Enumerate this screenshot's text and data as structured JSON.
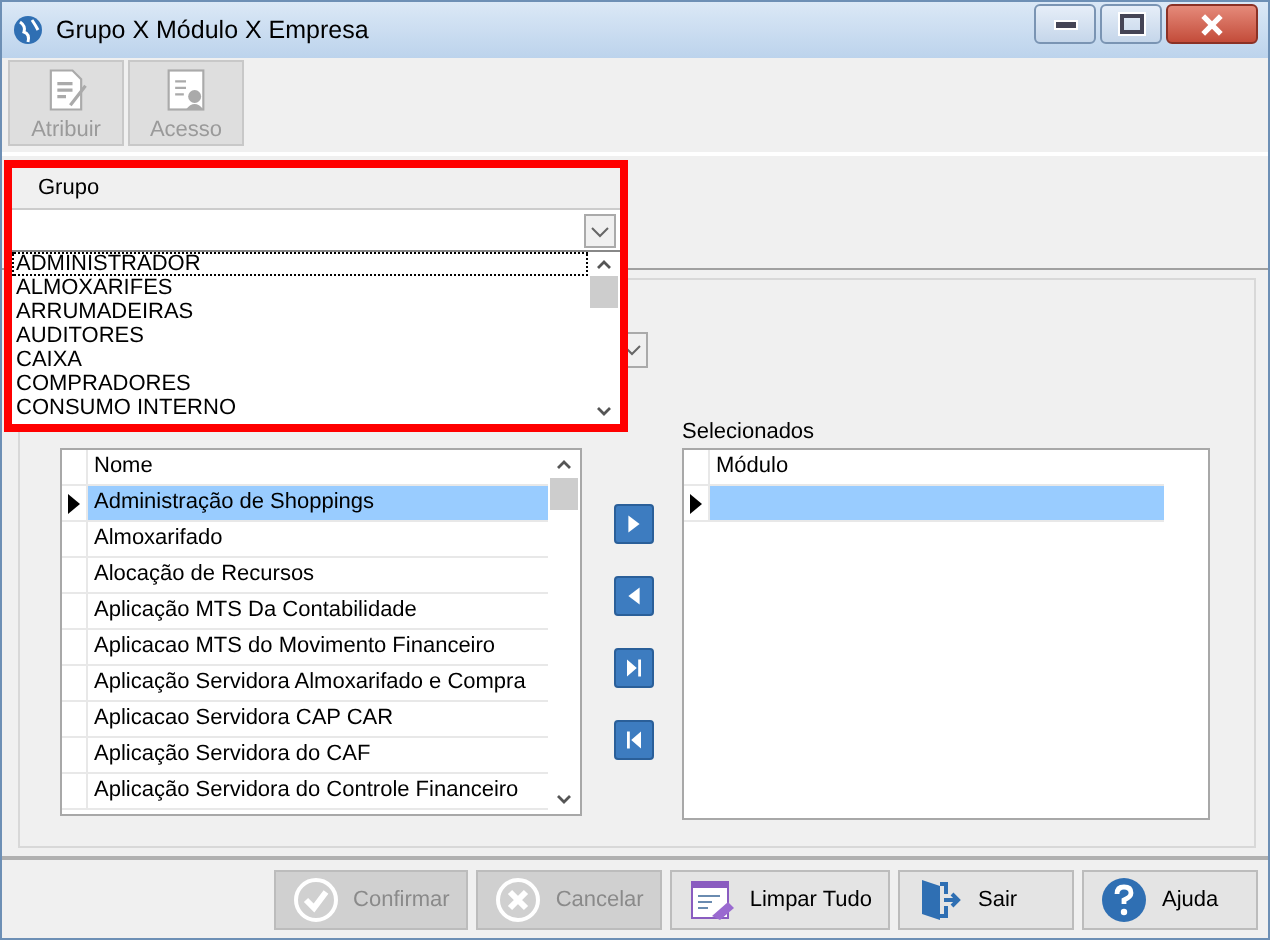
{
  "window": {
    "title": "Grupo X Módulo X Empresa"
  },
  "toolbar": [
    {
      "label": "Atribuir",
      "kind": "assign",
      "disabled": true
    },
    {
      "label": "Acesso",
      "kind": "access",
      "disabled": true
    }
  ],
  "grupo": {
    "label": "Grupo",
    "options": [
      {
        "label": "ADMINISTRADOR",
        "selected": true
      },
      {
        "label": "ALMOXARIFES",
        "selected": false
      },
      {
        "label": "ARRUMADEIRAS",
        "selected": false
      },
      {
        "label": "AUDITORES",
        "selected": false
      },
      {
        "label": "CAIXA",
        "selected": false
      },
      {
        "label": "COMPRADORES",
        "selected": false
      },
      {
        "label": "CONSUMO INTERNO",
        "selected": false
      }
    ]
  },
  "available": {
    "column": "Nome",
    "rows": [
      {
        "name": "Administração de Shoppings",
        "selected": true
      },
      {
        "name": "Almoxarifado",
        "selected": false
      },
      {
        "name": "Alocação de Recursos",
        "selected": false
      },
      {
        "name": "Aplicação MTS Da Contabilidade",
        "selected": false
      },
      {
        "name": "Aplicacao MTS do Movimento Financeiro",
        "selected": false
      },
      {
        "name": "Aplicação Servidora Almoxarifado e Compra",
        "selected": false
      },
      {
        "name": "Aplicacao Servidora CAP CAR",
        "selected": false
      },
      {
        "name": "Aplicação Servidora do CAF",
        "selected": false
      },
      {
        "name": "Aplicação Servidora do Controle Financeiro",
        "selected": false
      }
    ]
  },
  "move_buttons": [
    {
      "kind": "add"
    },
    {
      "kind": "remove"
    },
    {
      "kind": "add_all"
    },
    {
      "kind": "remove_all"
    }
  ],
  "selected_list": {
    "label": "Selecionados",
    "column": "Módulo",
    "rows": [
      {
        "selected": true
      }
    ]
  },
  "buttons": [
    {
      "label": "Confirmar",
      "kind": "confirm",
      "disabled": true
    },
    {
      "label": "Cancelar",
      "kind": "cancel",
      "disabled": true
    },
    {
      "label": "Limpar Tudo",
      "kind": "clear",
      "disabled": false
    },
    {
      "label": "Sair",
      "kind": "exit",
      "disabled": false
    },
    {
      "label": "Ajuda",
      "kind": "help",
      "disabled": false
    }
  ]
}
